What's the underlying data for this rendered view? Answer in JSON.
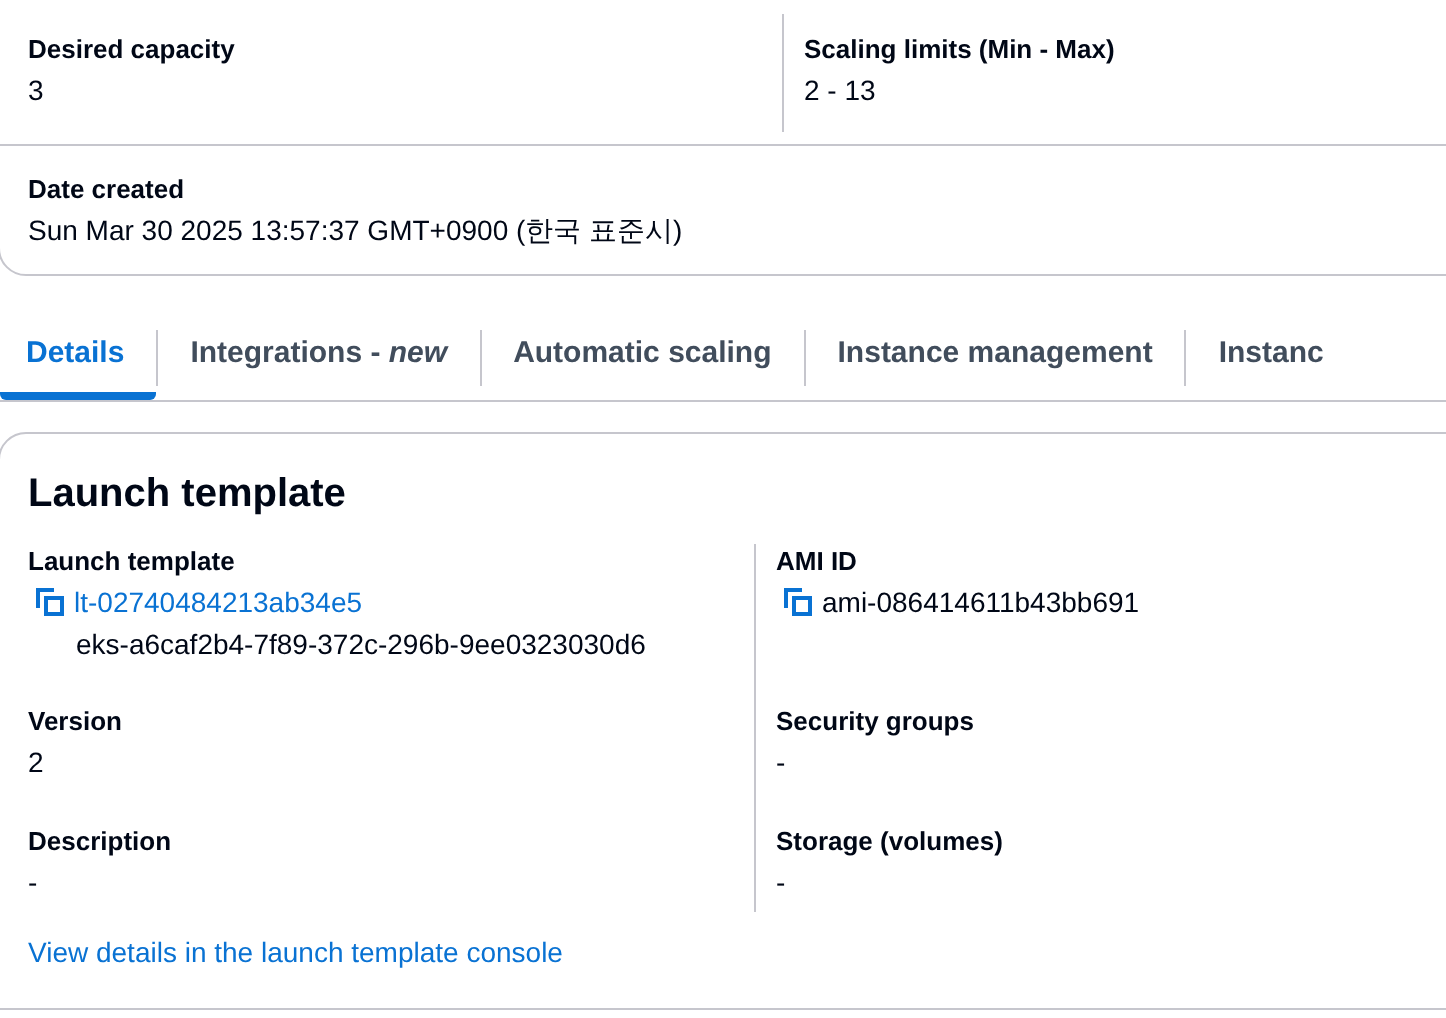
{
  "summary": {
    "fields": [
      {
        "label": "Desired capacity",
        "value": "3"
      },
      {
        "label": "Scaling limits (Min - Max)",
        "value": "2 - 13"
      }
    ],
    "date": {
      "label": "Date created",
      "value": "Sun Mar 30 2025 13:57:37 GMT+0900 (한국 표준시)"
    }
  },
  "tabs": [
    {
      "label": "Details",
      "selected": true
    },
    {
      "label": "Integrations - *new*",
      "selected": false
    },
    {
      "label": "Automatic scaling",
      "selected": false
    },
    {
      "label": "Instance management",
      "selected": false
    },
    {
      "label": "Instanc",
      "selected": false
    }
  ],
  "launch_template": {
    "title": "Launch template",
    "left": [
      {
        "label": "Launch template",
        "kind": "link",
        "value": "lt-02740484213ab34e5",
        "sub": "eks-a6caf2b4-7f89-372c-296b-9ee0323030d6"
      },
      {
        "label": "Version",
        "kind": "text",
        "value": "2"
      },
      {
        "label": "Description",
        "kind": "text",
        "value": "-"
      }
    ],
    "right": [
      {
        "label": "AMI ID",
        "kind": "copy",
        "value": "ami-086414611b43bb691"
      },
      {
        "label": "Security groups",
        "kind": "text",
        "value": "-"
      },
      {
        "label": "Storage (volumes)",
        "kind": "text",
        "value": "-"
      }
    ],
    "footer_link": "View details in the launch template console"
  }
}
